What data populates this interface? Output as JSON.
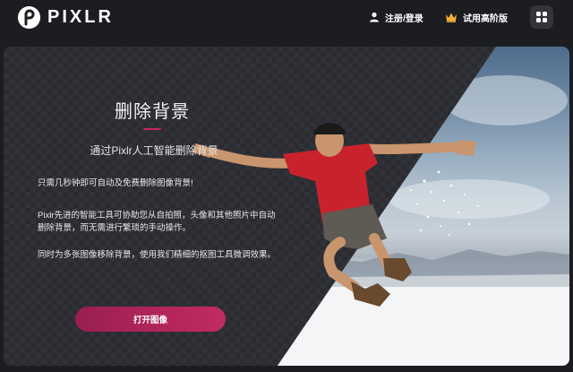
{
  "header": {
    "logo_text": "PIXLR",
    "login_label": "注册/登录",
    "premium_label": "试用高阶版"
  },
  "hero": {
    "title": "删除背景",
    "subtitle": "通过Pixlr人工智能删除背景",
    "paragraphs": [
      "只需几秒钟即可自动及免费删除图像背景!",
      "Pixlr先进的智能工具可协助您从自拍照，头像和其他照片中自动删除背景，而无需进行繁琐的手动操作。",
      "同时为多张图像移除背景，使用我们精细的抠图工具微调效果。"
    ],
    "open_button_label": "打开图像"
  },
  "colors": {
    "accent": "#c22a62",
    "background": "#1c1d21",
    "shirt": "#c8232c",
    "premium_crown": "#f2b233"
  },
  "icons": {
    "login": "user-icon",
    "premium": "crown-icon",
    "apps": "grid-icon",
    "logo": "pixlr-logo-icon"
  }
}
